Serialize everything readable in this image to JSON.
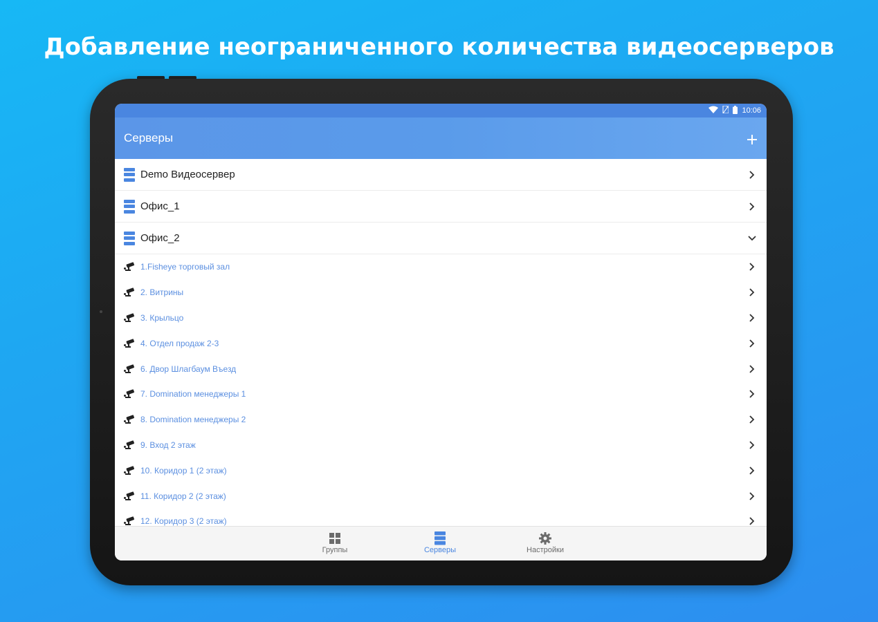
{
  "headline": "Добавление неограниченного количества видеосерверов",
  "status_bar": {
    "time": "10:06",
    "icons": [
      "wifi-icon",
      "sim-icon",
      "battery-icon"
    ]
  },
  "app_bar": {
    "title": "Серверы",
    "add_icon": "plus-icon"
  },
  "servers": [
    {
      "name": "Demo Видеосервер",
      "state": "collapsed"
    },
    {
      "name": "Офис_1",
      "state": "collapsed"
    },
    {
      "name": "Офис_2",
      "state": "expanded"
    }
  ],
  "cameras": [
    "1.Fisheye торговый зал",
    "2. Витрины",
    "3. Крыльцо",
    "4. Отдел продаж 2-3",
    "6. Двор Шлагбаум Въезд",
    "7. Domination менеджеры 1",
    "8. Domination менеджеры 2",
    "9. Вход 2 этаж",
    "10. Коридор 1 (2 этаж)",
    "11. Коридор 2 (2 этаж)",
    "12. Коридор 3 (2 этаж)"
  ],
  "bottom_nav": [
    {
      "label": "Группы",
      "icon": "grid-icon",
      "active": false
    },
    {
      "label": "Серверы",
      "icon": "server-icon",
      "active": true
    },
    {
      "label": "Настройки",
      "icon": "gear-icon",
      "active": false
    }
  ],
  "colors": {
    "accent": "#4a86e0",
    "background_top": "#17b8f5",
    "background_bottom": "#2d8ef0"
  }
}
